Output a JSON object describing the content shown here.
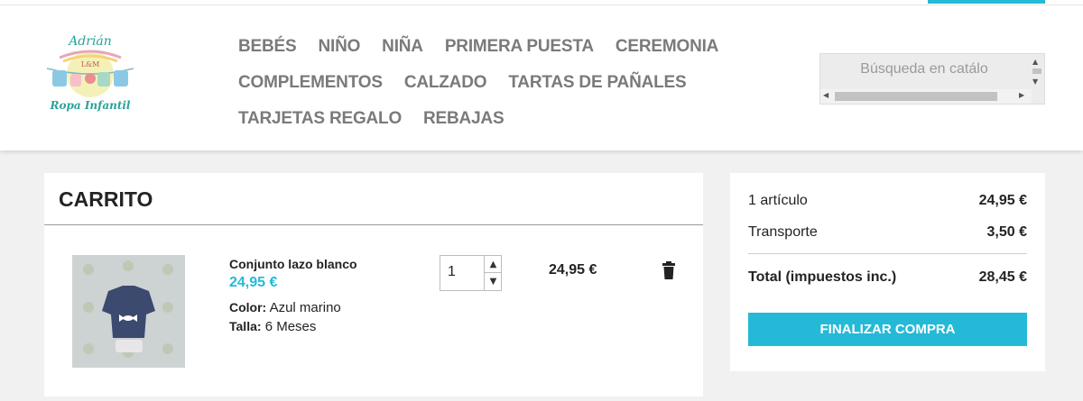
{
  "header": {
    "logo": {
      "name_top": "Adrián",
      "monogram": "L&M",
      "name_bottom": "Ropa Infantil"
    },
    "nav": {
      "row1": [
        "BEBÉS",
        "NIÑO",
        "NIÑA",
        "PRIMERA PUESTA",
        "CEREMONIA"
      ],
      "row2": [
        "COMPLEMENTOS",
        "CALZADO",
        "TARTAS DE PAÑALES"
      ],
      "row3": [
        "TARJETAS REGALO",
        "REBAJAS"
      ]
    },
    "search": {
      "placeholder": "Búsqueda en catálo"
    }
  },
  "cart": {
    "title": "CARRITO",
    "items": [
      {
        "name": "Conjunto lazo blanco",
        "unit_price": "24,95 €",
        "color_label": "Color:",
        "color_value": "Azul marino",
        "size_label": "Talla:",
        "size_value": "6 Meses",
        "quantity": "1",
        "line_total": "24,95 €",
        "delete_icon": "trash-icon"
      }
    ]
  },
  "summary": {
    "items_label": "1 artículo",
    "items_value": "24,95 €",
    "shipping_label": "Transporte",
    "shipping_value": "3,50 €",
    "total_label": "Total (impuestos inc.)",
    "total_value": "28,45 €",
    "checkout_label": "FINALIZAR COMPRA"
  },
  "colors": {
    "accent": "#24b9d7",
    "nav_text": "#7a7a7a",
    "background": "#f1f1f1"
  }
}
